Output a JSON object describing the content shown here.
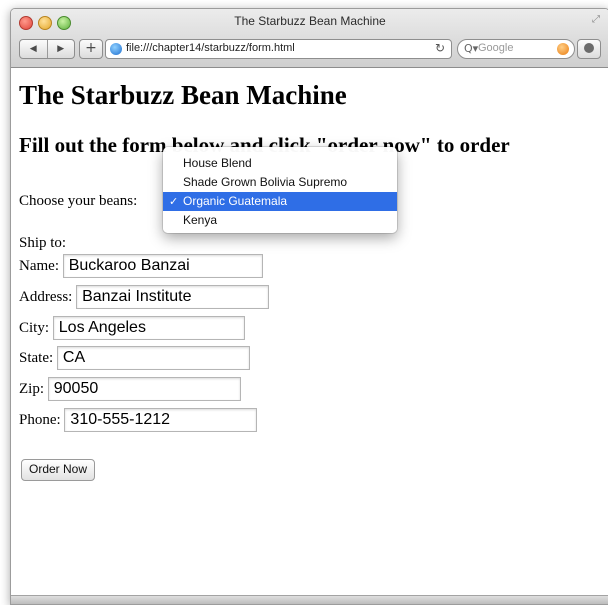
{
  "window": {
    "title": "The Starbuzz Bean Machine",
    "resize_icon": "resize-icon"
  },
  "toolbar": {
    "back_glyph": "◀",
    "forward_glyph": "▶",
    "add_glyph": "+",
    "url": "file:///chapter14/starbuzz/form.html",
    "reload_glyph": "↻",
    "search_placeholder": "Google",
    "search_glyph": "Q▾"
  },
  "page": {
    "heading": "The Starbuzz Bean Machine",
    "subheading": "Fill out the form below and click \"order now\" to order",
    "beans_label": "Choose your beans:",
    "ship_to_label": "Ship to:",
    "fields": [
      {
        "label": "Name:",
        "value": "Buckaroo Banzai"
      },
      {
        "label": "Address:",
        "value": "Banzai Institute"
      },
      {
        "label": "City:",
        "value": "Los Angeles"
      },
      {
        "label": "State:",
        "value": "CA"
      },
      {
        "label": "Zip:",
        "value": "90050"
      },
      {
        "label": "Phone:",
        "value": "310-555-1212"
      }
    ],
    "order_button": "Order Now"
  },
  "beans_select": {
    "check_glyph": "✓",
    "options": [
      "House Blend",
      "Shade Grown Bolivia Supremo",
      "Organic Guatemala",
      "Kenya"
    ],
    "selected": "Organic Guatemala",
    "selected_color": "#2f6ee6"
  }
}
